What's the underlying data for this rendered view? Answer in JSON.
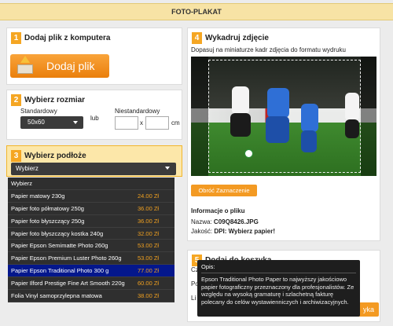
{
  "header": {
    "title": "FOTO-PLAKAT"
  },
  "step1": {
    "num": "1",
    "title": "Dodaj plik z komputera",
    "button": "Dodaj plik"
  },
  "step2": {
    "num": "2",
    "title": "Wybierz rozmiar",
    "standard_label": "Standardowy",
    "standard_value": "50x60",
    "or": "lub",
    "custom_label": "Niestandardowy",
    "times": "x",
    "unit": "cm"
  },
  "step3": {
    "num": "3",
    "title": "Wybierz podłoże",
    "select_value": "Wybierz",
    "options": [
      {
        "name": "Wybierz",
        "price": ""
      },
      {
        "name": "Papier matowy 230g",
        "price": "24.00 Zł"
      },
      {
        "name": "Papier foto półmatowy 250g",
        "price": "36.00 Zł"
      },
      {
        "name": "Papier foto błyszczący 250g",
        "price": "36.00 Zł"
      },
      {
        "name": "Papier foto błyszczący kostka 240g",
        "price": "32.00 Zł"
      },
      {
        "name": "Papier Epson Semimatte Photo 260g",
        "price": "53.00 Zł"
      },
      {
        "name": "Papier Epson Premium Luster Photo 260g",
        "price": "53.00 Zł"
      },
      {
        "name": "Papier Epson Traditional Photo 300 g",
        "price": "77.00 Zł"
      },
      {
        "name": "Papier Ilford Prestige Fine Art Smooth 220g",
        "price": "60.00 Zł"
      },
      {
        "name": "Folia Vinyl samoprzylepna matowa",
        "price": "38.00 Zł"
      }
    ],
    "active_index": 7
  },
  "step4": {
    "num": "4",
    "title": "Wykadruj zdjęcie",
    "hint": "Dopasuj na miniaturze kadr zdjęcia do formatu wydruku",
    "rotate_button": "Obróć Zaznaczenie",
    "info_title": "Informacje o pliku",
    "name_label": "Nazwa:",
    "name_value": "C09Q8426.JPG",
    "quality_label": "Jakość:",
    "quality_value": "DPI: Wybierz papier!"
  },
  "step5": {
    "num": "5",
    "title": "Dodaj do koszyka",
    "order_partial": "yka",
    "cover_text_1": "Cz",
    "cover_text_2": "Po",
    "cover_text_3": "Li"
  },
  "tooltip": {
    "title": "Opis:",
    "text": "Epson Traditional Photo Paper to najwyższy jakościowo papier fotograficzny przeznaczony dla profesjonalistów. Ze względu na wysoką gramaturę i szlachetną fakturę polecany do celów wystawienniczych i archiwizacyjnych."
  },
  "colors": {
    "accent": "#f39a23",
    "header_bg": "#f7e3a5",
    "dropdown_bg": "#2f2f2f",
    "active_option": "#04178c",
    "price": "#f0a020"
  }
}
